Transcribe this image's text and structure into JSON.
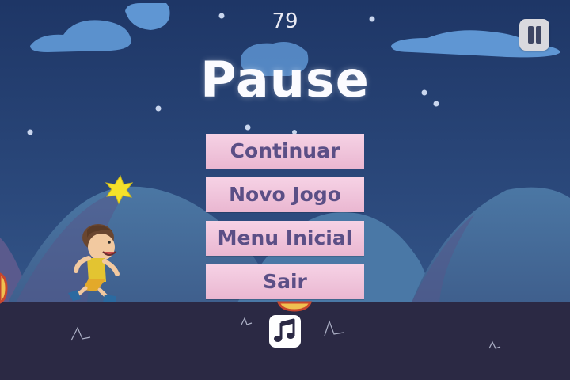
{
  "hud": {
    "score": "79"
  },
  "pause_menu": {
    "title": "Pause",
    "buttons": [
      {
        "label": "Continuar"
      },
      {
        "label": "Novo Jogo"
      },
      {
        "label": "Menu Inicial"
      },
      {
        "label": "Sair"
      }
    ]
  },
  "icons": {
    "pause": "pause-icon",
    "music": "music-note-icon"
  },
  "colors": {
    "sky": "#2a4679",
    "ground": "#2b2944",
    "button_fill": "#f3c6dc",
    "button_text": "#5b4f86",
    "title": "#ffffff"
  }
}
